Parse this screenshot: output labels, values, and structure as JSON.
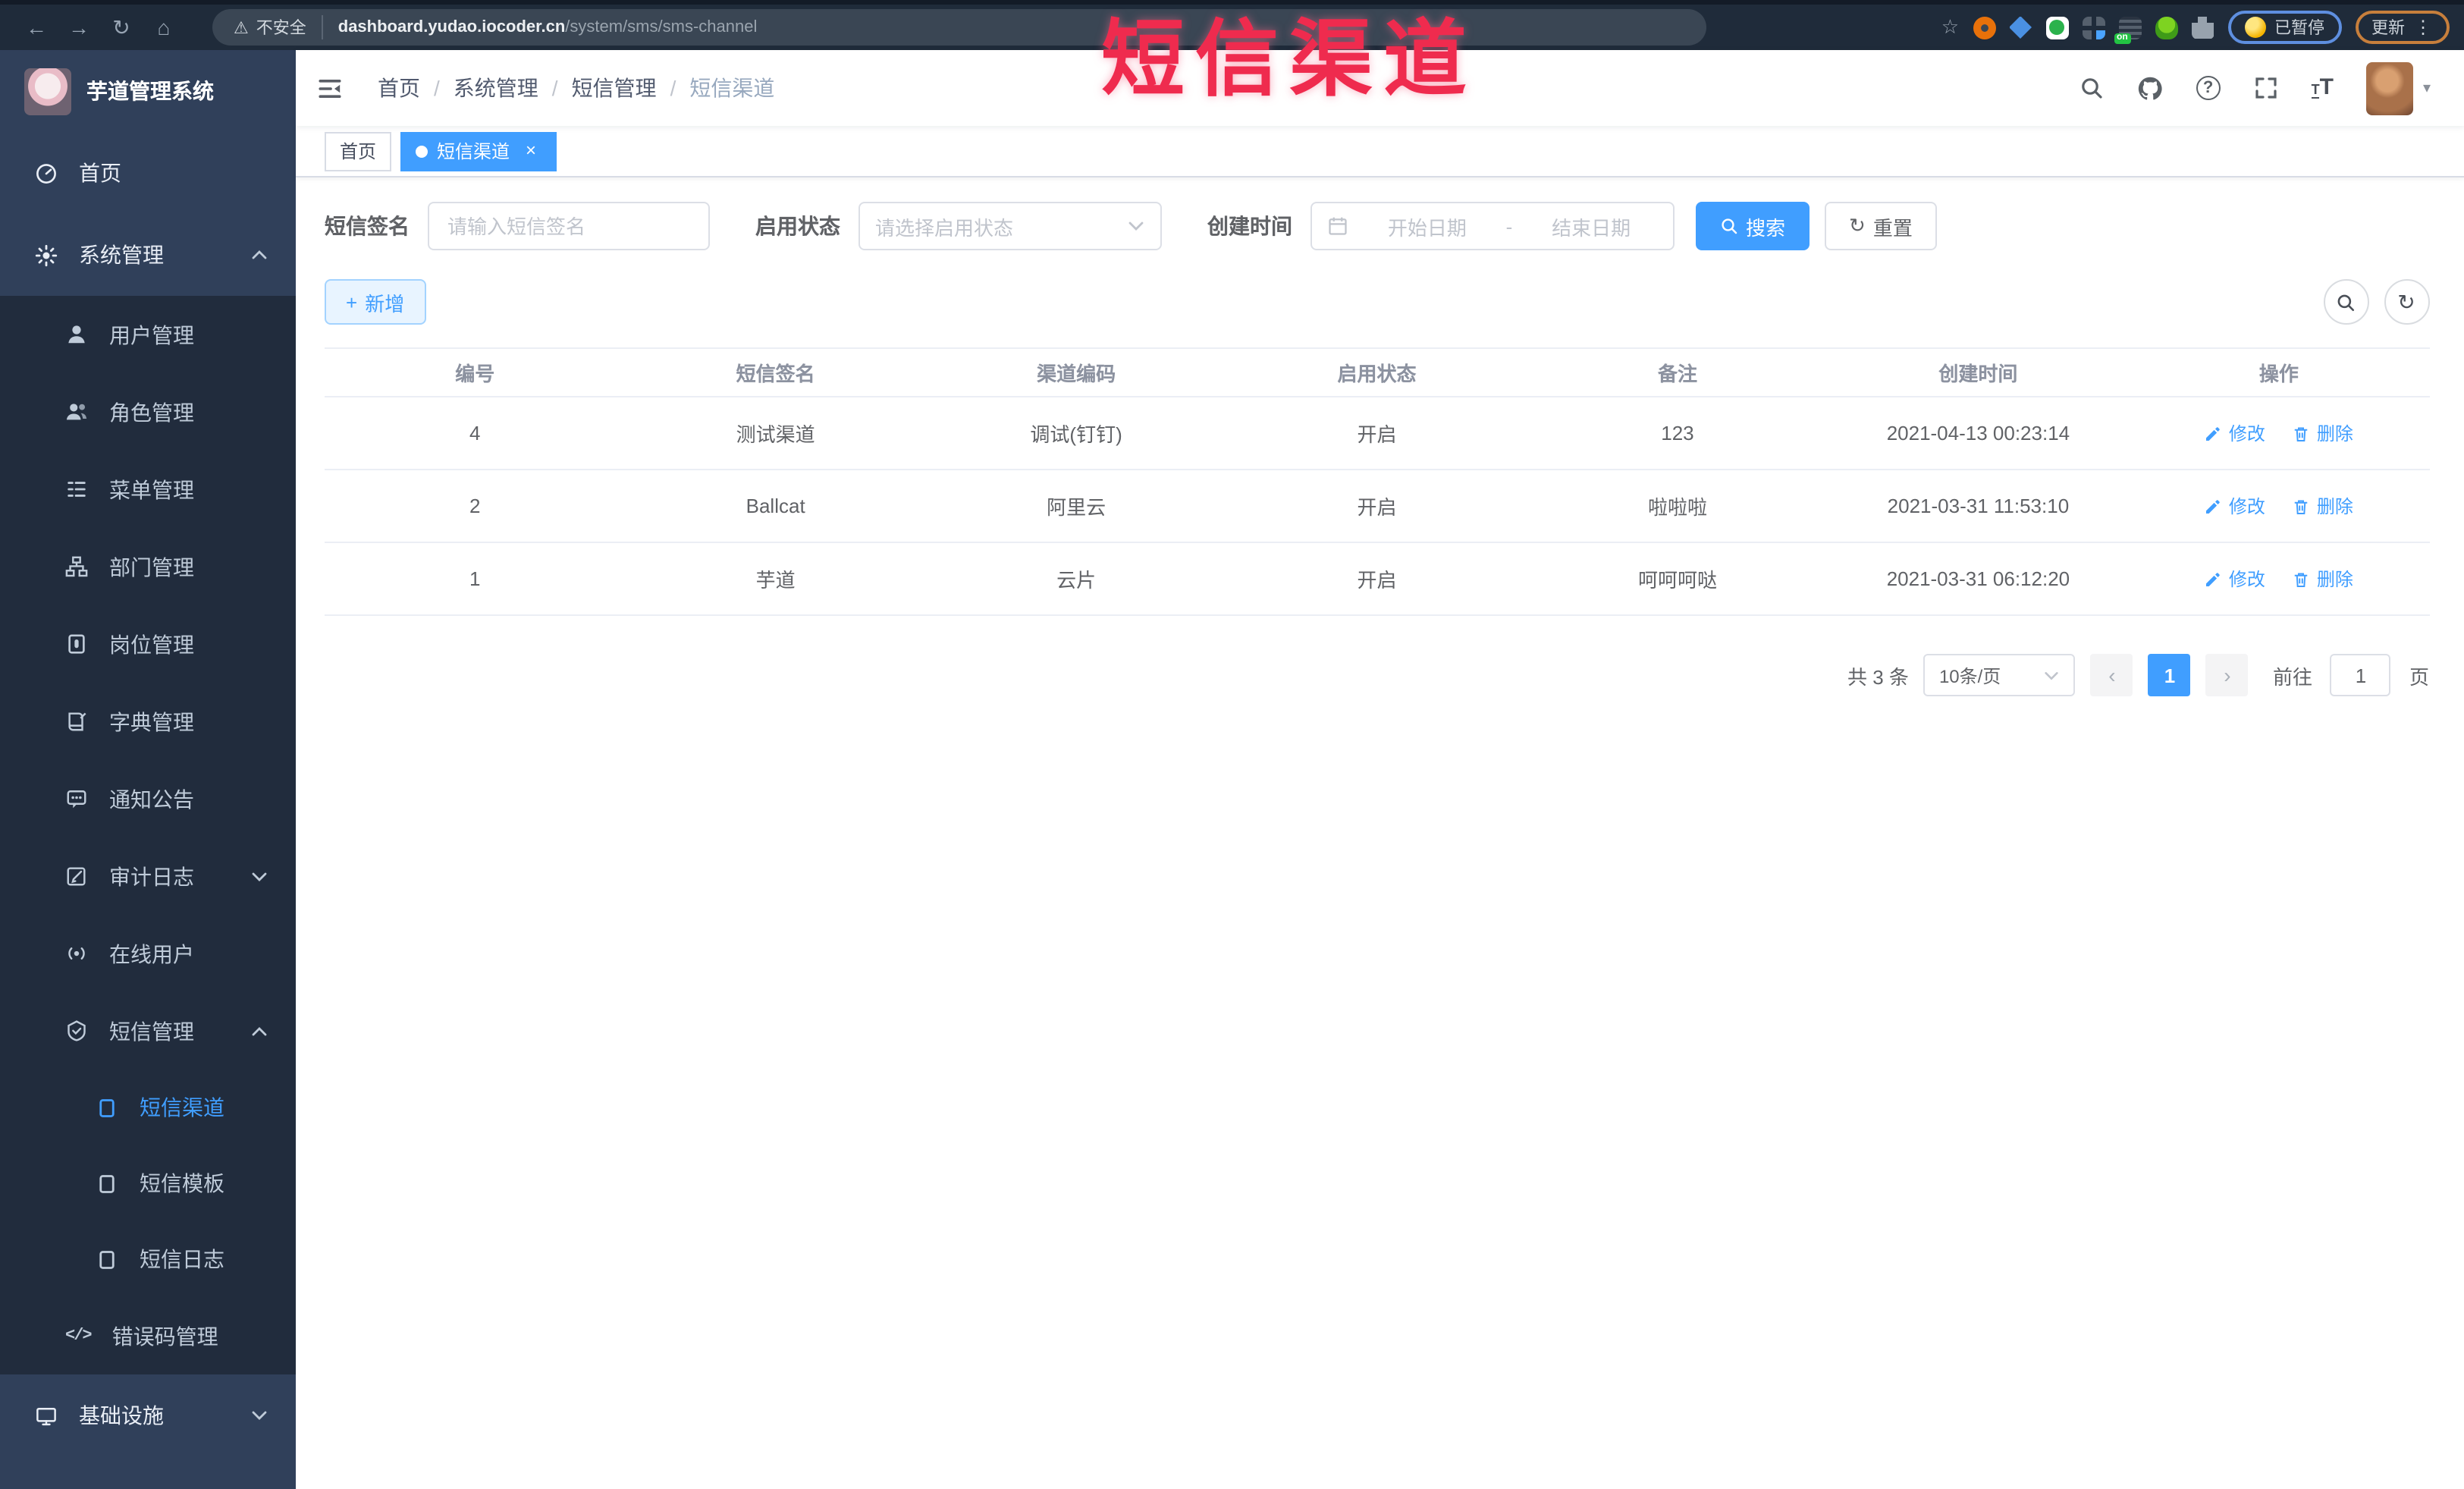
{
  "browser": {
    "back_glyph": "←",
    "forward_glyph": "→",
    "reload_glyph": "↻",
    "home_glyph": "⌂",
    "warning_glyph": "⚠",
    "security_label": "不安全",
    "url_domain": "dashboard.yudao.iocoder.cn",
    "url_path": "/system/sms/sms-channel",
    "bookmark_glyph": "☆",
    "ext_on_badge": "on",
    "paused_label": "已暂停",
    "update_label": "更新",
    "kebab_glyph": "⋮"
  },
  "overlay": {
    "title": "短信渠道",
    "color": "#ef2b4e"
  },
  "sidebar": {
    "app_title": "芋道管理系统",
    "items": [
      {
        "label": "首页"
      },
      {
        "label": "系统管理"
      },
      {
        "label": "用户管理"
      },
      {
        "label": "角色管理"
      },
      {
        "label": "菜单管理"
      },
      {
        "label": "部门管理"
      },
      {
        "label": "岗位管理"
      },
      {
        "label": "字典管理"
      },
      {
        "label": "通知公告"
      },
      {
        "label": "审计日志"
      },
      {
        "label": "在线用户"
      },
      {
        "label": "短信管理"
      },
      {
        "label": "短信渠道"
      },
      {
        "label": "短信模板"
      },
      {
        "label": "短信日志"
      },
      {
        "label": "错误码管理"
      },
      {
        "label": "基础设施"
      }
    ]
  },
  "header": {
    "breadcrumb": {
      "items": [
        "首页",
        "系统管理",
        "短信管理",
        "短信渠道"
      ],
      "separator": "/"
    },
    "help_glyph": "?",
    "caret_glyph": "▾",
    "size_small_glyph": "T",
    "size_large_glyph": "T"
  },
  "tabs": [
    {
      "label": "首页"
    },
    {
      "label": "短信渠道",
      "close_glyph": "×"
    }
  ],
  "filters": {
    "sign_label": "短信签名",
    "sign_placeholder": "请输入短信签名",
    "status_label": "启用状态",
    "status_placeholder": "请选择启用状态",
    "time_label": "创建时间",
    "start_placeholder": "开始日期",
    "range_separator": "-",
    "end_placeholder": "结束日期",
    "search_label": "搜索",
    "reset_label": "重置",
    "reset_glyph": "↻"
  },
  "toolbar": {
    "add_label": "新增",
    "plus_glyph": "+",
    "refresh_glyph": "↻"
  },
  "table": {
    "columns": [
      "编号",
      "短信签名",
      "渠道编码",
      "启用状态",
      "备注",
      "创建时间",
      "操作"
    ],
    "rows": [
      {
        "id": "4",
        "sign": "测试渠道",
        "code": "调试(钉钉)",
        "status": "开启",
        "remark": "123",
        "created": "2021-04-13 00:23:14"
      },
      {
        "id": "2",
        "sign": "Ballcat",
        "code": "阿里云",
        "status": "开启",
        "remark": "啦啦啦",
        "created": "2021-03-31 11:53:10"
      },
      {
        "id": "1",
        "sign": "芋道",
        "code": "云片",
        "status": "开启",
        "remark": "呵呵呵哒",
        "created": "2021-03-31 06:12:20"
      }
    ],
    "edit_label": "修改",
    "delete_label": "删除"
  },
  "pagination": {
    "total_label": "共 3 条",
    "page_size_value": "10条/页",
    "prev_glyph": "‹",
    "current_page": "1",
    "next_glyph": "›",
    "goto_label": "前往",
    "goto_value": "1",
    "unit_label": "页"
  },
  "accent": {
    "primary": "#409eff",
    "sidebar_bg": "#30405a",
    "submenu_bg": "#212c3d"
  }
}
